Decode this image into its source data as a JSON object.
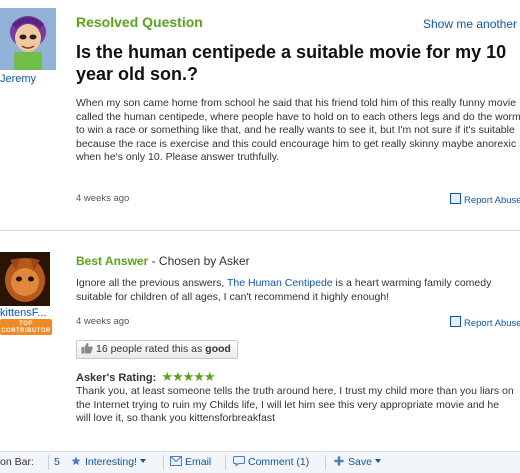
{
  "question": {
    "status": "Resolved Question",
    "show_another": "Show me another »",
    "asker": "Jeremy",
    "title": "Is the human centipede a suitable movie for my 10 year old son.?",
    "body": "When my son came home from school he said that his friend told him of this really funny movie called the human centipede, where people have to hold on to each others legs and do the worm to win a race or something like that, and he really wants to see it, but I'm not sure if it's suitable because the race is exercise and this could encourage him to get really skinny maybe anorexic when he's only 10. Please answer truthfully.",
    "time_ago": "4 weeks ago",
    "report": "Report Abuse"
  },
  "answer": {
    "answerer": "kittensF...",
    "badge_line1": "TOP",
    "badge_line2": "CONTRIBUTOR",
    "best_label": "Best Answer",
    "chosen_by": " - Chosen by Asker",
    "body_before": "Ignore all the previous answers, ",
    "link_text": "The Human Centipede",
    "body_after": " is a heart warming family comedy suitable for children of all ages, I can't recommend it highly enough!",
    "time_ago": "4 weeks ago",
    "report": "Report Abuse",
    "rated_prefix": "16 people rated this as ",
    "rated_word": "good",
    "askers_rating_label": "Asker's Rating:",
    "stars": "★★★★★",
    "star_count": 5,
    "askers_comment": "Thank you, at least someone tells the truth around here, I trust my child more than you liars on the Internet trying to ruin my Childs life, I will let him see this very appropriate movie and he will love it, so thank you kittensforbreakfast"
  },
  "action_bar": {
    "label": "on Bar:",
    "interesting_count": "5",
    "interesting": "Interesting!",
    "email": "Email",
    "comment": "Comment (1)",
    "save": "Save"
  },
  "colors": {
    "accent_green": "#5aa31b",
    "link_blue": "#1155aa",
    "badge_orange": "#f08a24"
  },
  "icons": [
    "flag-icon",
    "thumbs-up-icon",
    "star-icon",
    "envelope-icon",
    "comment-icon",
    "plus-icon",
    "chevron-down-icon"
  ]
}
